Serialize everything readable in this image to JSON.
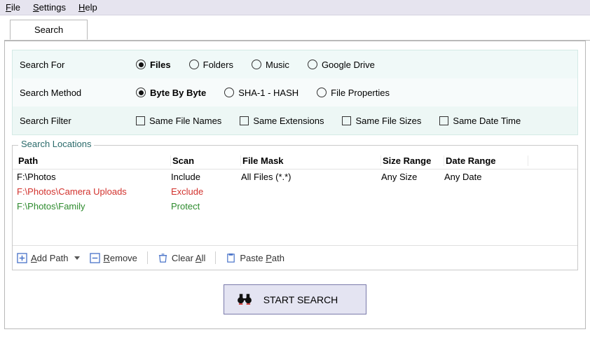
{
  "menu": {
    "file": "File",
    "settings": "Settings",
    "help": "Help"
  },
  "tab": {
    "search": "Search"
  },
  "criteria": {
    "search_for_label": "Search For",
    "search_method_label": "Search Method",
    "search_filter_label": "Search Filter",
    "for_opts": {
      "files": "Files",
      "folders": "Folders",
      "music": "Music",
      "gdrive": "Google Drive"
    },
    "method_opts": {
      "byte": "Byte By Byte",
      "sha1": "SHA-1 - HASH",
      "props": "File Properties"
    },
    "filter_opts": {
      "names": "Same File Names",
      "exts": "Same Extensions",
      "sizes": "Same File Sizes",
      "dates": "Same Date Time"
    }
  },
  "locations": {
    "legend": "Search Locations",
    "headers": {
      "path": "Path",
      "scan": "Scan",
      "mask": "File Mask",
      "size": "Size Range",
      "date": "Date Range"
    },
    "rows": [
      {
        "path": "F:\\Photos",
        "scan": "Include",
        "mask": "All Files (*.*)",
        "size": "Any Size",
        "date": "Any Date",
        "mode": "include"
      },
      {
        "path": "F:\\Photos\\Camera Uploads",
        "scan": "Exclude",
        "mask": "",
        "size": "",
        "date": "",
        "mode": "exclude"
      },
      {
        "path": "F:\\Photos\\Family",
        "scan": "Protect",
        "mask": "",
        "size": "",
        "date": "",
        "mode": "protect"
      }
    ],
    "toolbar": {
      "add": "Add Path",
      "remove": "Remove",
      "clear": "Clear All",
      "paste": "Paste Path"
    }
  },
  "start_label": "START SEARCH"
}
